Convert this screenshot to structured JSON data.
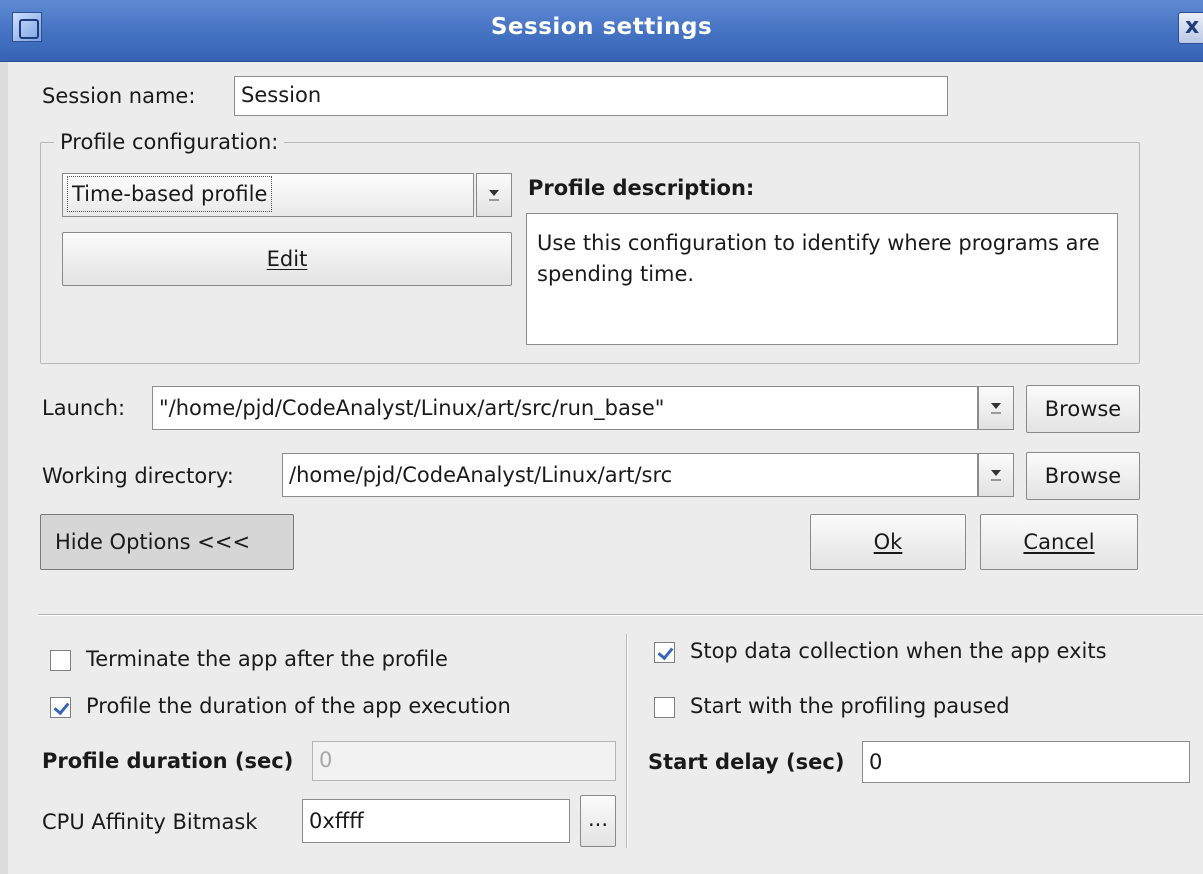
{
  "window": {
    "title": "Session settings",
    "close_glyph": "x"
  },
  "session": {
    "label": "Session name:",
    "value": "Session"
  },
  "profile": {
    "group_label": "Profile configuration:",
    "selected": "Time-based profile",
    "edit_button": "Edit",
    "description_label": "Profile description:",
    "description": "Use this configuration to identify where programs are spending time."
  },
  "launch": {
    "label": "Launch:",
    "value": "\"/home/pjd/CodeAnalyst/Linux/art/src/run_base\"",
    "browse": "Browse"
  },
  "workdir": {
    "label": "Working directory:",
    "value": "/home/pjd/CodeAnalyst/Linux/art/src",
    "browse": "Browse"
  },
  "buttons": {
    "hide_options": "Hide Options <<<",
    "ok": "Ok",
    "cancel": "Cancel"
  },
  "options": {
    "terminate": {
      "label": "Terminate the app after the profile",
      "checked": false
    },
    "profile_duration_check": {
      "label": "Profile the duration of the app execution",
      "checked": true
    },
    "duration": {
      "label": "Profile duration (sec)",
      "value": "0"
    },
    "affinity": {
      "label": "CPU Affinity Bitmask",
      "value": "0xffff",
      "button": "..."
    },
    "stop_collection": {
      "label": "Stop data collection when the app exits",
      "checked": true
    },
    "start_paused": {
      "label": "Start with the profiling paused",
      "checked": false
    },
    "start_delay": {
      "label": "Start delay (sec)",
      "value": "0"
    }
  },
  "colors": {
    "titlebar": "#4472c2",
    "check_mark": "#3966b8",
    "dialog_bg": "#ececec"
  }
}
